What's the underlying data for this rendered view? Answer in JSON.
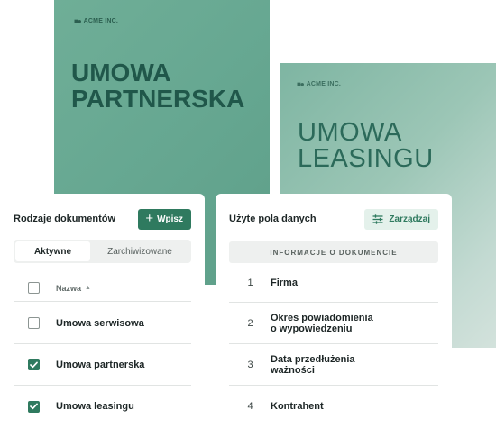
{
  "covers": [
    {
      "brand": "ACME INC.",
      "logo": "■●",
      "title_lines": [
        "UMOWA",
        "PARTNERSKA"
      ]
    },
    {
      "brand": "ACME INC.",
      "logo": "■●",
      "title_lines": [
        "UMOWA",
        "LEASINGU"
      ]
    }
  ],
  "document_types": {
    "title": "Rodzaje dokumentów",
    "add_button": {
      "icon": "plus-icon",
      "label": "Wpisz"
    },
    "tabs": [
      {
        "label": "Aktywne",
        "active": true
      },
      {
        "label": "Zarchiwizowane",
        "active": false
      }
    ],
    "column_name": "Nazwa",
    "sort": "ascending",
    "items": [
      {
        "label": "Umowa serwisowa",
        "checked": false
      },
      {
        "label": "Umowa partnerska",
        "checked": true
      },
      {
        "label": "Umowa leasingu",
        "checked": true
      }
    ]
  },
  "data_fields": {
    "title": "Użyte pola danych",
    "manage_button": {
      "icon": "sliders-icon",
      "label": "Zarządzaj"
    },
    "section": "Informacje o dokumencie",
    "fields": [
      {
        "num": "1",
        "lines": [
          "Firma"
        ]
      },
      {
        "num": "2",
        "lines": [
          "Okres powiadomienia",
          "o wypowiedzeniu"
        ]
      },
      {
        "num": "3",
        "lines": [
          "Data przedłużenia",
          "ważności"
        ]
      },
      {
        "num": "4",
        "lines": [
          "Kontrahent"
        ]
      }
    ]
  },
  "colors": {
    "accent": "#2f7a5f",
    "accent_soft": "#e4f1eb",
    "cover_partnerska": "#67a892",
    "cover_leasingu": "#9cc6b6"
  }
}
